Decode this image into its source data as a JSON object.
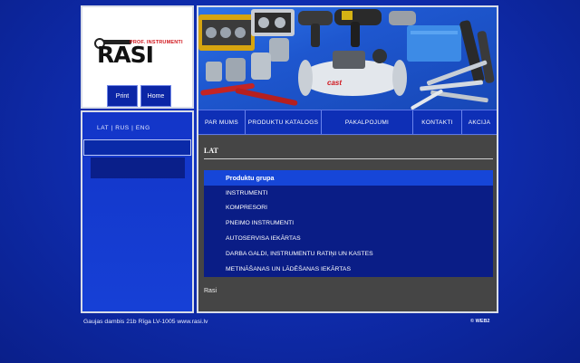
{
  "logo": {
    "brand": "RASI",
    "tagline": "PROF. INSTRUMENTI"
  },
  "toolbar": {
    "print_label": "Print",
    "home_label": "Home"
  },
  "sidebar": {
    "languages": "LAT | RUS | ENG",
    "search_value": ""
  },
  "banner": {
    "brand_on_compressor": "cast"
  },
  "nav": {
    "items": [
      {
        "label": "PAR MUMS"
      },
      {
        "label": "PRODUKTU KATALOGS"
      },
      {
        "label": "PAKALPOJUMI"
      },
      {
        "label": "KONTAKTI"
      },
      {
        "label": "AKCIJA"
      }
    ]
  },
  "content": {
    "section_title": "LAT",
    "menu_header": "Produktu grupa",
    "menu_items": [
      "INSTRUMENTI",
      "KOMPRESORI",
      "PNEIMO INSTRUMENTI",
      "AUTOSERVISA IEKĀRTAS",
      "DARBA GALDI, INSTRUMENTU RATIŅI UN KASTES",
      "METINĀŠANAS UN LĀDĒŠANAS IEKĀRTAS"
    ],
    "footer_text": "Rasi"
  },
  "footer": {
    "address": "Gaujas dambis 21b  Rīga  LV-1005  www.rasi.lv",
    "copyright": "© WEB2"
  },
  "colors": {
    "background": "#0f2db0",
    "panel_blue": "#1335c8",
    "menu_dark": "#0a1d86",
    "menu_header": "#1646d8",
    "content_gray": "#454545",
    "logo_red": "#d0141b"
  }
}
